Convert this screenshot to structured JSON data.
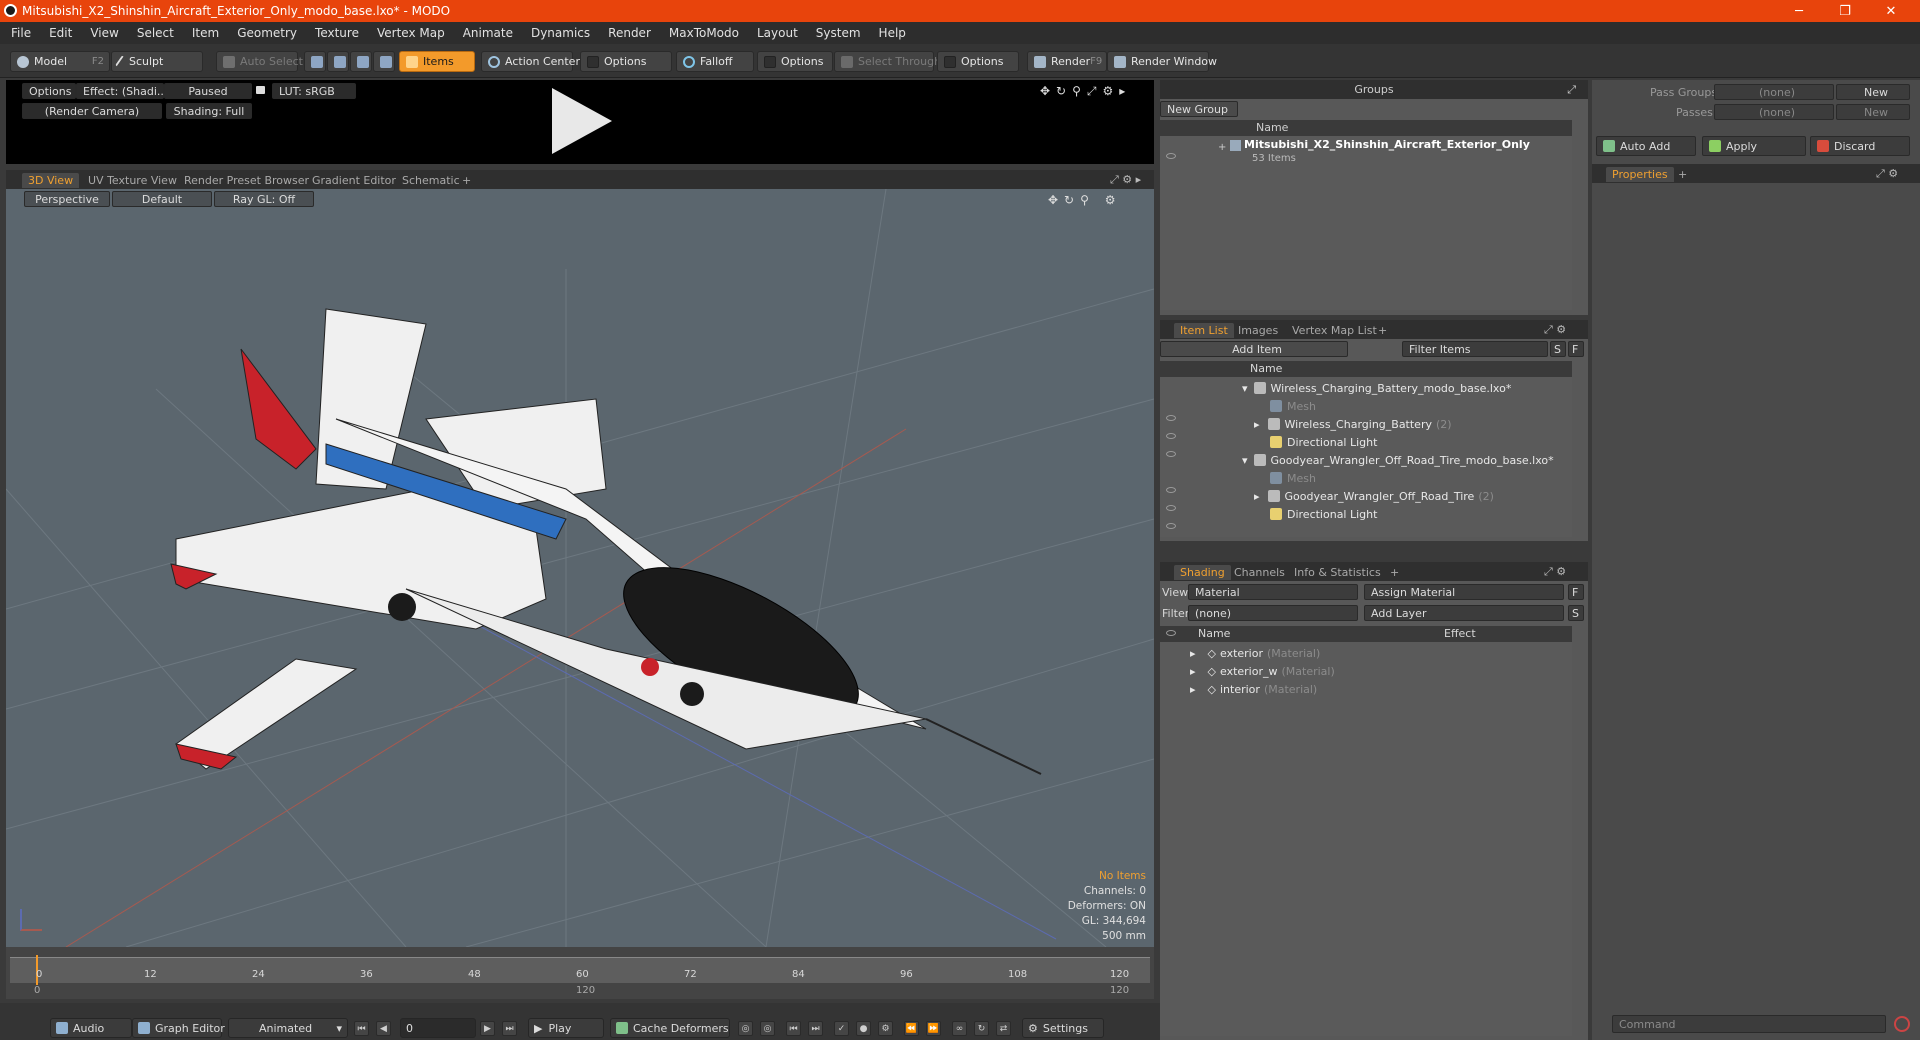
{
  "window": {
    "title": "Mitsubishi_X2_Shinshin_Aircraft_Exterior_Only_modo_base.lxo* - MODO",
    "minimize": "─",
    "restore": "❐",
    "close": "✕"
  },
  "menu": [
    "File",
    "Edit",
    "View",
    "Select",
    "Item",
    "Geometry",
    "Texture",
    "Vertex Map",
    "Animate",
    "Dynamics",
    "Render",
    "MaxToModo",
    "Layout",
    "System",
    "Help"
  ],
  "toolbar": {
    "model": "Model",
    "model_key": "F2",
    "sculpt": "Sculpt",
    "auto_select": "Auto Select",
    "items": "Items",
    "action_center": "Action Center",
    "options1": "Options",
    "falloff": "Falloff",
    "options2": "Options",
    "select_through": "Select Through",
    "options3": "Options",
    "render": "Render",
    "render_key": "F9",
    "render_window": "Render Window"
  },
  "preview": {
    "options": "Options",
    "effect": "Effect: (Shadi...",
    "paused": "Paused",
    "lut": "LUT: sRGB",
    "camera": "(Render Camera)",
    "shading": "Shading: Full"
  },
  "viewport_tabs": [
    "3D View",
    "UV Texture View",
    "Render Preset Browser",
    "Gradient Editor",
    "Schematic"
  ],
  "viewport": {
    "perspective": "Perspective",
    "default": "Default",
    "raygl": "Ray GL: Off",
    "stats": {
      "no_items": "No Items",
      "channels": "Channels: 0",
      "deformers": "Deformers: ON",
      "gl": "GL: 344,694",
      "scale": "500 mm"
    }
  },
  "timeline": {
    "ticks": [
      "0",
      "12",
      "24",
      "36",
      "48",
      "60",
      "72",
      "84",
      "96",
      "108",
      "120"
    ],
    "sub_ticks": [
      "0",
      "120",
      "120"
    ]
  },
  "bottombar": {
    "audio": "Audio",
    "graph_editor": "Graph Editor",
    "animated": "Animated",
    "frame": "0",
    "play": "Play",
    "cache_deformers": "Cache Deformers",
    "settings": "Settings"
  },
  "groups": {
    "title": "Groups",
    "new_group": "New Group",
    "col_name": "Name",
    "item_name": "Mitsubishi_X2_Shinshin_Aircraft_Exterior_Only",
    "item_count": "53 Items"
  },
  "itemlist": {
    "tabs": [
      "Item List",
      "Images",
      "Vertex Map List"
    ],
    "add_item": "Add Item",
    "filter": "Filter Items",
    "btn_s": "S",
    "btn_f": "F",
    "col_name": "Name",
    "rows": [
      {
        "label": "Wireless_Charging_Battery_modo_base.lxo*",
        "suffix": ""
      },
      {
        "label": "Mesh",
        "suffix": ""
      },
      {
        "label": "Wireless_Charging_Battery",
        "suffix": "(2)"
      },
      {
        "label": "Directional Light",
        "suffix": ""
      },
      {
        "label": "Goodyear_Wrangler_Off_Road_Tire_modo_base.lxo*",
        "suffix": ""
      },
      {
        "label": "Mesh",
        "suffix": ""
      },
      {
        "label": "Goodyear_Wrangler_Off_Road_Tire",
        "suffix": "(2)"
      },
      {
        "label": "Directional Light",
        "suffix": ""
      }
    ]
  },
  "shading": {
    "tabs": [
      "Shading",
      "Channels",
      "Info & Statistics"
    ],
    "view_label": "View",
    "view_value": "Material",
    "assign_material": "Assign Material",
    "filter_label": "Filter",
    "filter_value": "(none)",
    "add_layer": "Add Layer",
    "btn_f": "F",
    "btn_s": "S",
    "col_name": "Name",
    "col_effect": "Effect",
    "rows": [
      {
        "label": "exterior",
        "type": "(Material)"
      },
      {
        "label": "exterior_w",
        "type": "(Material)"
      },
      {
        "label": "interior",
        "type": "(Material)"
      }
    ]
  },
  "right": {
    "pass_groups": "Pass Groups",
    "passes": "Passes",
    "none1": "(none)",
    "none2": "(none)",
    "new1": "New",
    "new2": "New",
    "auto_add": "Auto Add",
    "apply": "Apply",
    "discard": "Discard",
    "properties": "Properties",
    "command": "Command"
  },
  "colors": {
    "title_bar": "#e8440c",
    "accent": "#f39a2a",
    "viewport_bg": "#5b666e"
  }
}
